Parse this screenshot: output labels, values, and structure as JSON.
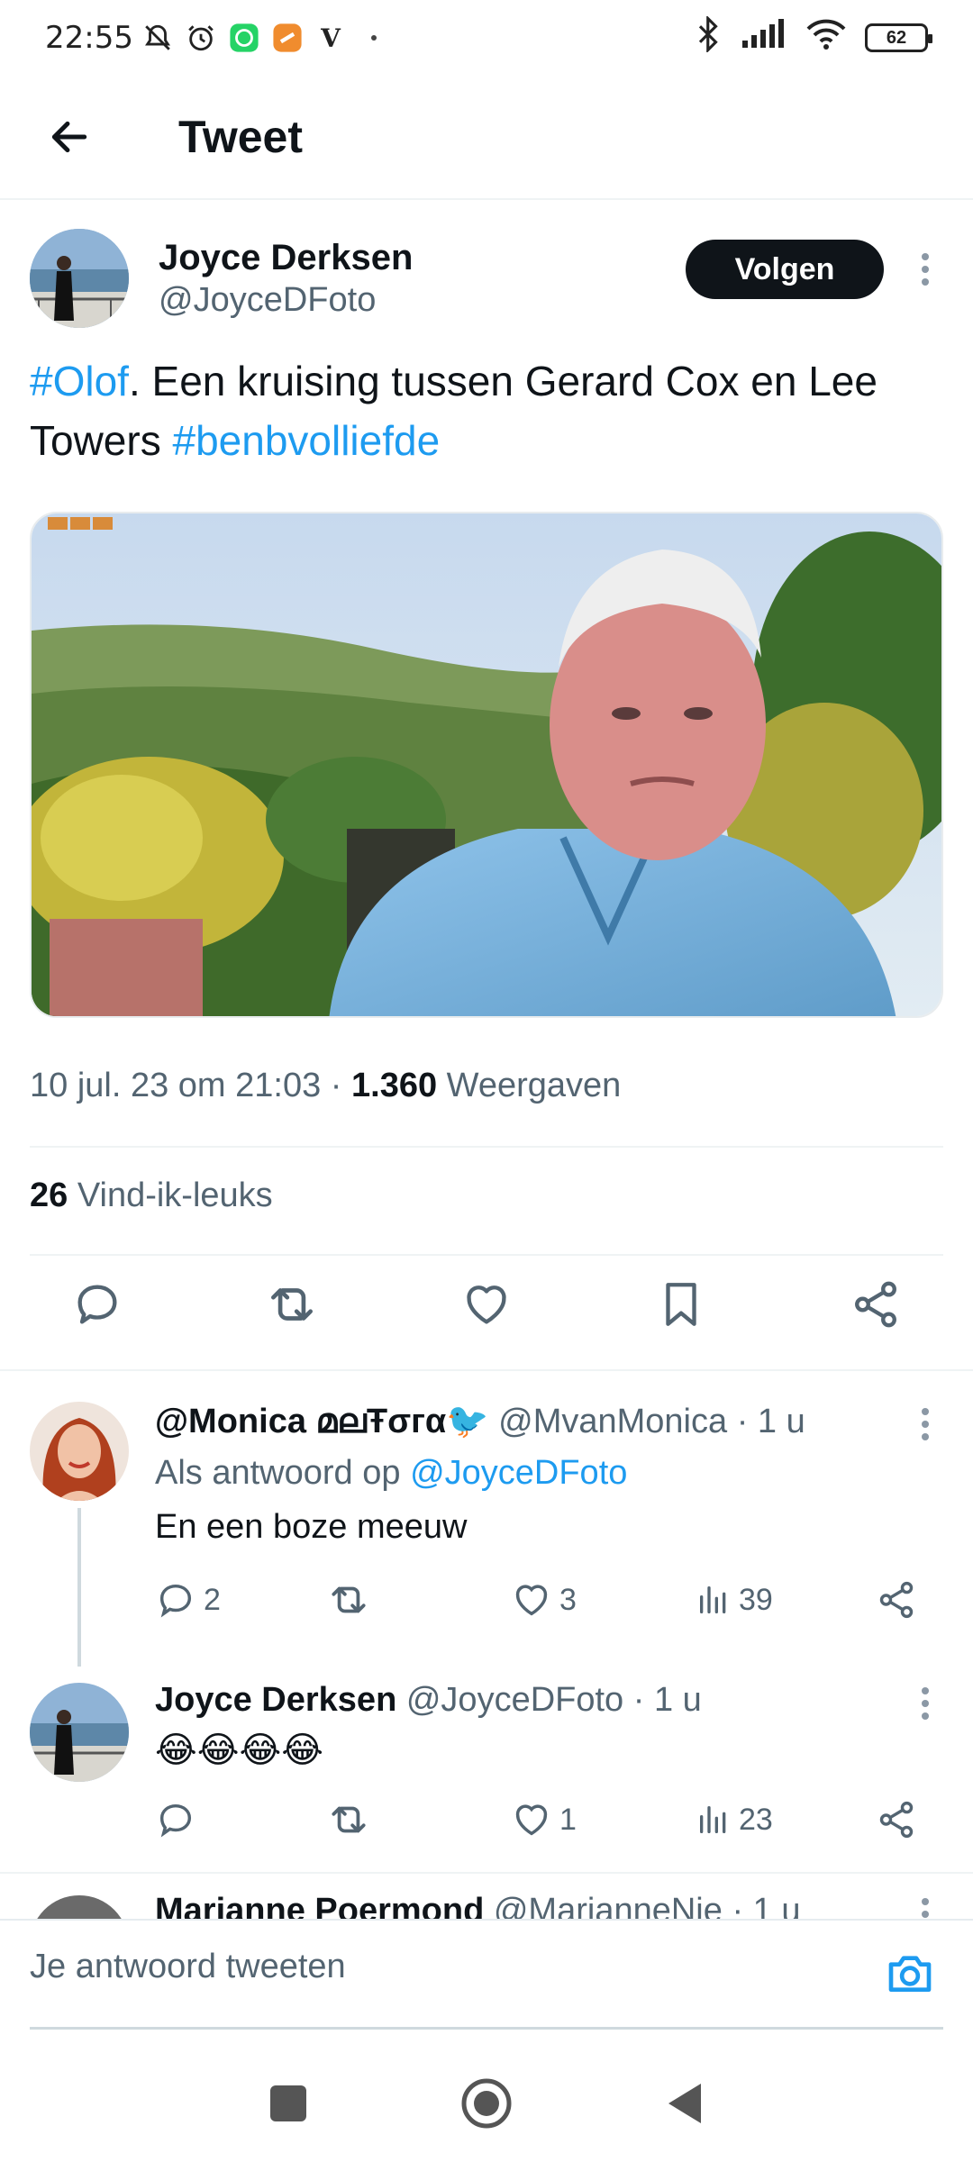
{
  "status_bar": {
    "time": "22:55",
    "carrier_glyph": "V",
    "battery": "62",
    "icons": [
      "mute-icon",
      "alarm-icon",
      "whatsapp-icon",
      "app-icon",
      "bluetooth-icon",
      "signal-icon",
      "wifi-icon",
      "battery-icon"
    ]
  },
  "header": {
    "title": "Tweet"
  },
  "tweet": {
    "author_name": "Joyce Derksen",
    "author_handle": "@JoyceDFoto",
    "follow_label": "Volgen",
    "text_parts": [
      {
        "type": "hashtag",
        "text": "#Olof"
      },
      {
        "type": "text",
        "text": ". Een kruising tussen Gerard Cox en Lee Towers "
      },
      {
        "type": "hashtag",
        "text": "#benbvolliefde"
      }
    ],
    "date": "10 jul. 23 om 21:03",
    "separator": " · ",
    "views_count": "1.360",
    "views_label": " Weergaven",
    "likes_count": "26",
    "likes_label": " Vind-ik-leuks",
    "media_badge": "RTL"
  },
  "replies": [
    {
      "name": "@Monica മലŦσгα🐦",
      "handle": "@MvanMonica",
      "time": "· 1 u",
      "reply_to_label": "Als antwoord op ",
      "reply_to_handle": "@JoyceDFoto",
      "text": "En een boze meeuw",
      "replies_count": "2",
      "likes_count": "3",
      "views_count": "39"
    },
    {
      "name": "Joyce Derksen",
      "handle": "@JoyceDFoto",
      "time": "· 1 u",
      "text": "😂😂😂😂",
      "replies_count": "",
      "likes_count": "1",
      "views_count": "23"
    },
    {
      "name": "Marianne Poermond",
      "handle": "@MarianneNie",
      "time": "· 1 u"
    }
  ],
  "reply_bar": {
    "placeholder": "Je antwoord tweeten"
  },
  "colors": {
    "accent": "#1d9bf0",
    "text": "#0f1419",
    "muted": "#536471"
  }
}
